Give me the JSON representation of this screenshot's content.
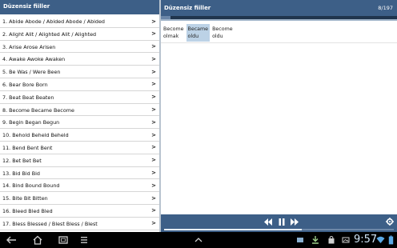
{
  "left_panel": {
    "title": "Düzensiz fiiller",
    "items": [
      {
        "label": "1. Abide Abode / Abided Abode / Abided"
      },
      {
        "label": "2. Alight Alit / Alighted Alit / Alighted"
      },
      {
        "label": "3. Arise Arose Arisen"
      },
      {
        "label": "4. Awake Awoke Awaken"
      },
      {
        "label": "5. Be Was / Were Been"
      },
      {
        "label": "6. Bear Bore Born"
      },
      {
        "label": "7. Beat Beat Beaten"
      },
      {
        "label": "8. Become Became Become"
      },
      {
        "label": "9. Begin Began Begun"
      },
      {
        "label": "10. Behold Beheld Beheld"
      },
      {
        "label": "11. Bend Bent Bent"
      },
      {
        "label": "12. Bet Bet Bet"
      },
      {
        "label": "13. Bid Bid Bid"
      },
      {
        "label": "14. Bind Bound Bound"
      },
      {
        "label": "15. Bite Bit Bitten"
      },
      {
        "label": "16. Bleed Bled Bled"
      },
      {
        "label": "17. Bless Blessed / Blest Bless / Blest"
      }
    ],
    "arrow": ">"
  },
  "right_panel": {
    "title": "Düzensiz fiiller",
    "counter": "8/197",
    "progress": 0.04,
    "forms": [
      {
        "word": "Become",
        "meaning": "olmak",
        "selected": false
      },
      {
        "word": "Became",
        "meaning": "oldu",
        "selected": true
      },
      {
        "word": "Become",
        "meaning": "oldu",
        "selected": false
      }
    ]
  },
  "player": {
    "progress": 0.6,
    "icons": [
      "rewind-icon",
      "pause-icon",
      "fast-forward-icon",
      "settings-icon"
    ]
  },
  "system_bar": {
    "time": "9:57"
  },
  "colors": {
    "header": "#3d5f87",
    "selected": "#bcd2e6",
    "system_bar": "#000000"
  }
}
